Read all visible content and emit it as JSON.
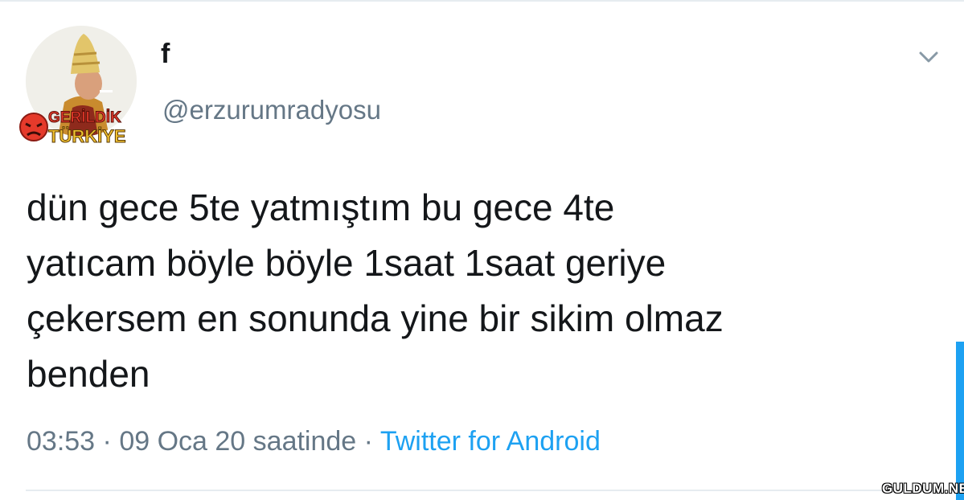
{
  "user": {
    "display_name": "f",
    "handle": "@erzurumradyosu",
    "avatar_icon": "avatar-portrait-icon",
    "badge_logo_text": "GERİLDİK TÜRKİYE"
  },
  "tweet": {
    "text": "dün gece 5te yatmıştım bu gece 4te\nyatıcam böyle böyle 1saat 1saat geriye\nçekersem en sonunda yine bir sikim olmaz\nbenden",
    "time": "03:53",
    "date": "09 Oca 20 saatinde",
    "separator": "·",
    "source": "Twitter for Android"
  },
  "watermark": "GULDUM.NET",
  "icons": {
    "menu": "chevron-down-icon"
  },
  "colors": {
    "text": "#14171a",
    "secondary": "#657786",
    "link": "#1da1f2",
    "border": "#e6ecf0"
  }
}
